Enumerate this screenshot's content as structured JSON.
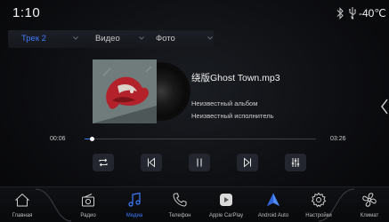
{
  "status_bar": {
    "clock": "1:10",
    "temperature": "-40℃",
    "icons": [
      "bluetooth-icon",
      "usb-icon"
    ]
  },
  "source_tabs": {
    "track": "Трек 2",
    "video": "Видео",
    "photo": "Фото",
    "active": "track"
  },
  "track": {
    "title": "绕版Ghost Town.mp3",
    "album": "Неизвестный альбом",
    "artist": "Неизвестный исполнитель"
  },
  "progress": {
    "elapsed": "00:06",
    "total": "03:26",
    "fraction": 0.03
  },
  "controls": [
    "repeat-icon",
    "previous-icon",
    "pause-icon",
    "next-icon",
    "equalizer-icon"
  ],
  "dock": {
    "home": "Главная",
    "radio": "Радио",
    "media": "Медиа",
    "phone": "Телефон",
    "carplay": "Apple CarPlay",
    "android_auto": "Android Auto",
    "settings": "Настройки",
    "climate": "Климат",
    "active": "media"
  },
  "colors": {
    "accent": "#3d7bff",
    "background": "#0c0d10",
    "button_bg": "#23262e"
  }
}
